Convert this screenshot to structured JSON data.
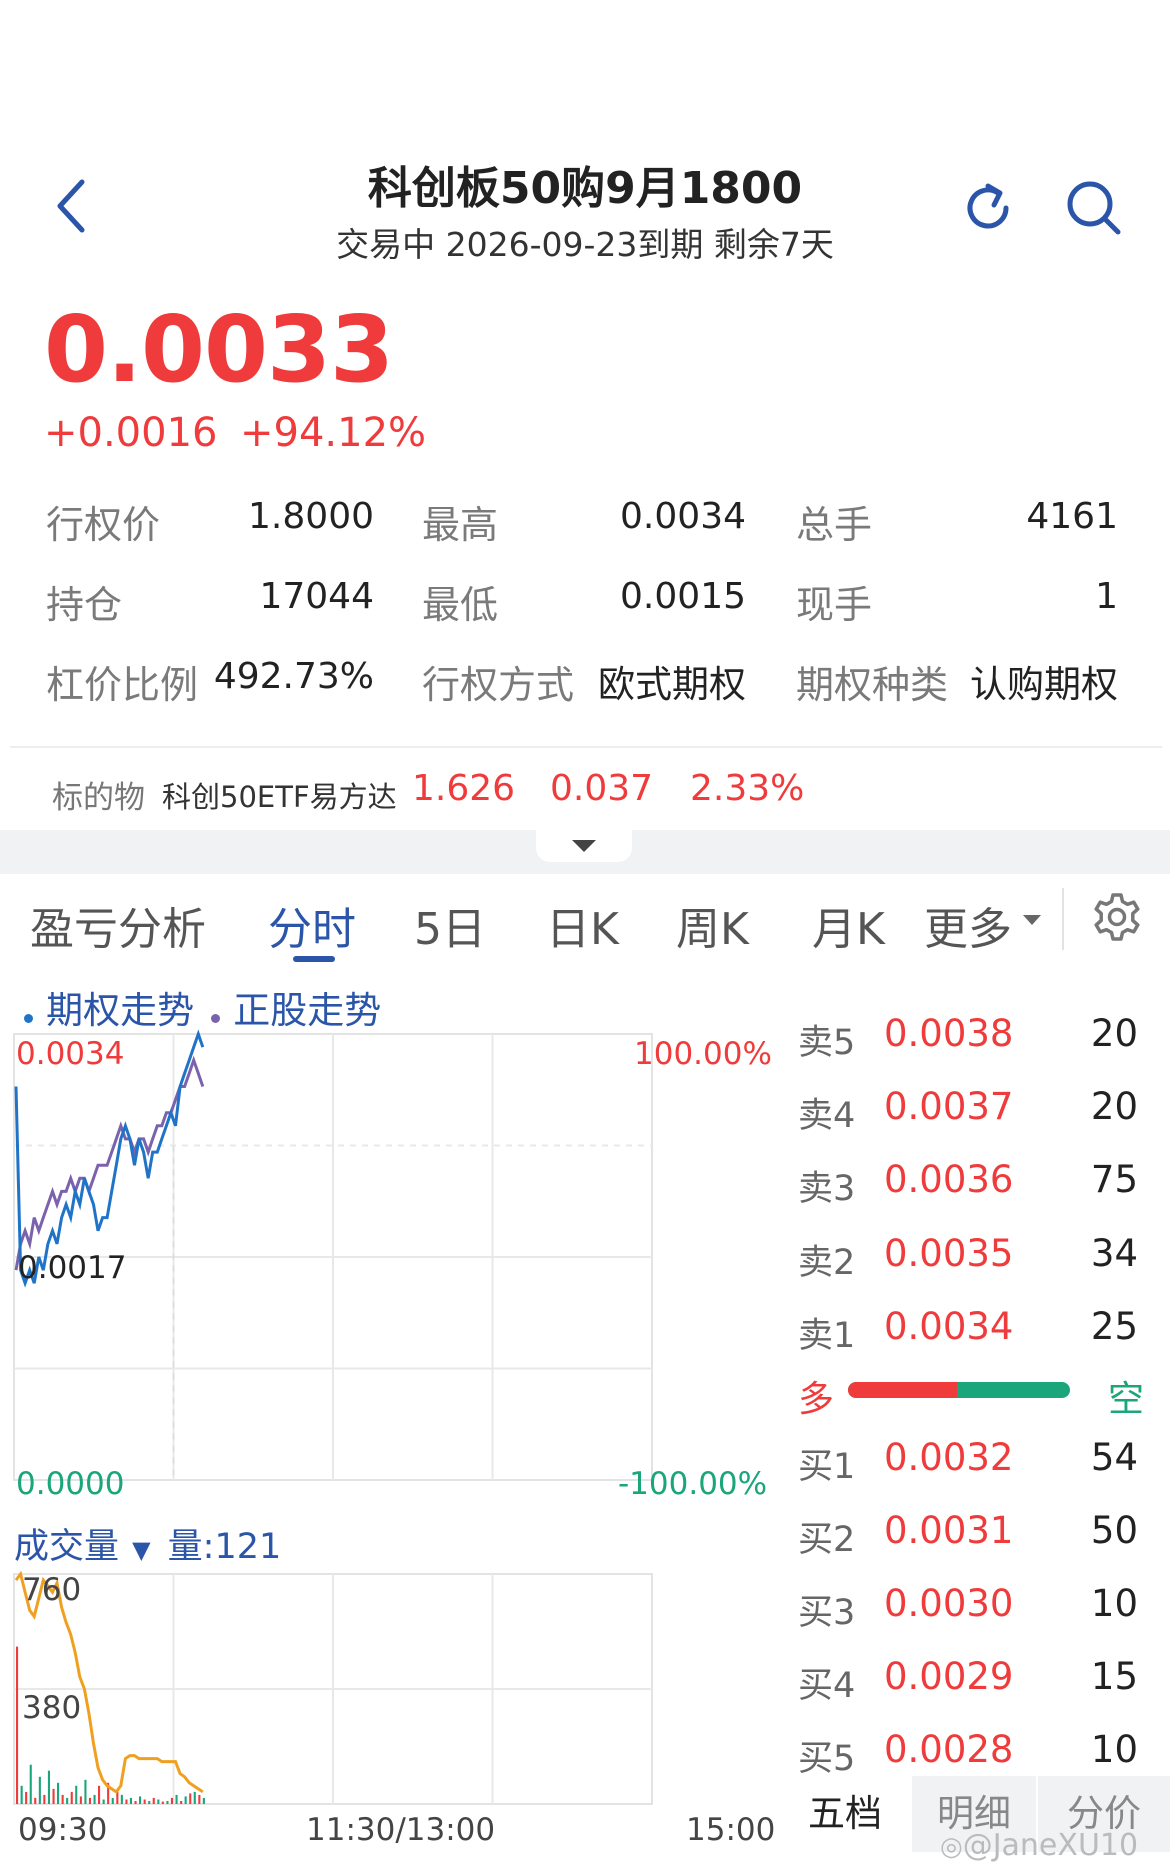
{
  "header": {
    "title": "科创板50购9月1800",
    "subtitle": "交易中 2026-09-23到期 剩余7天"
  },
  "quote": {
    "price": "0.0033",
    "change": "+0.0016",
    "change_pct": "+94.12%"
  },
  "stats": [
    {
      "label": "行权价",
      "value": "1.8000",
      "color": "#222222"
    },
    {
      "label": "最高",
      "value": "0.0034",
      "color": "#ef3b3b"
    },
    {
      "label": "总手",
      "value": "4161",
      "color": "#222222"
    },
    {
      "label": "持仓",
      "value": "17044",
      "color": "#222222"
    },
    {
      "label": "最低",
      "value": "0.0015",
      "color": "#1aa67a"
    },
    {
      "label": "现手",
      "value": "1",
      "color": "#222222"
    },
    {
      "label": "杠价比例",
      "value": "492.73%",
      "color": "#222222"
    },
    {
      "label": "行权方式",
      "value": "欧式期权",
      "color": "#222222"
    },
    {
      "label": "期权种类",
      "value": "认购期权",
      "color": "#222222"
    }
  ],
  "underlying": {
    "label": "标的物",
    "name": "科创50ETF易方达",
    "price": "1.626",
    "change": "0.037",
    "change_pct": "2.33%"
  },
  "tabs": [
    "盈亏分析",
    "分时",
    "5日",
    "日K",
    "周K",
    "月K",
    "更多"
  ],
  "active_tab": "分时",
  "legend": {
    "option": "期权走势",
    "stock": "正股走势"
  },
  "chart_data": [
    {
      "type": "line",
      "title": "",
      "series": [
        {
          "name": "期权走势",
          "color": "#1f74c8",
          "values": [
            0.003,
            0.0016,
            0.0015,
            0.0016,
            0.0015,
            0.0017,
            0.0016,
            0.0018,
            0.0019,
            0.0018,
            0.002,
            0.0021,
            0.002,
            0.0022,
            0.0021,
            0.0023,
            0.0022,
            0.0021,
            0.0019,
            0.002,
            0.002,
            0.0022,
            0.0024,
            0.0026,
            0.0027,
            0.0026,
            0.0024,
            0.0026,
            0.0025,
            0.0023,
            0.0025,
            0.0025,
            0.0026,
            0.0027,
            0.0028,
            0.0027,
            0.003,
            0.0031,
            0.0032,
            0.0033,
            0.0034,
            0.0033
          ]
        },
        {
          "name": "正股走势",
          "color": "#7b62ad",
          "values": [
            0.0016,
            0.0018,
            0.0019,
            0.0018,
            0.002,
            0.0019,
            0.002,
            0.0021,
            0.0022,
            0.0021,
            0.0022,
            0.0022,
            0.0023,
            0.0022,
            0.0023,
            0.0023,
            0.0022,
            0.0023,
            0.0024,
            0.0024,
            0.0024,
            0.0025,
            0.0026,
            0.0027,
            0.0026,
            0.0026,
            0.0025,
            0.0026,
            0.0026,
            0.0025,
            0.0026,
            0.0027,
            0.0027,
            0.0028,
            0.0028,
            0.0029,
            0.003,
            0.003,
            0.0031,
            0.0032,
            0.0031,
            0.003
          ]
        }
      ],
      "ylim": [
        0.0,
        0.0034
      ],
      "y_ticks_left": [
        "0.0034",
        "0.0017",
        "0.0000"
      ],
      "y_ticks_right": [
        "100.00%",
        "-100.00%"
      ],
      "grid": true
    },
    {
      "type": "bar",
      "title": "成交量",
      "volume_label": "量:121",
      "ylim": [
        0,
        760
      ],
      "y_ticks": [
        "760",
        "380"
      ],
      "x_ticks": [
        "09:30",
        "11:30/13:00",
        "15:00"
      ],
      "values": [
        520,
        60,
        40,
        130,
        20,
        90,
        30,
        110,
        50,
        70,
        30,
        20,
        40,
        60,
        25,
        80,
        20,
        30,
        60,
        15,
        70,
        20,
        40,
        30,
        15,
        20,
        10,
        25,
        15,
        10,
        20,
        15,
        8,
        10,
        20,
        30,
        10,
        25,
        35,
        40,
        30,
        20
      ],
      "bar_colors": [
        "#ef3b3b",
        "#1aa67a"
      ],
      "series": [
        {
          "name": "",
          "color": "#f0a020",
          "values": [
            740,
            760,
            700,
            640,
            620,
            680,
            740,
            720,
            700,
            730,
            650,
            600,
            560,
            500,
            420,
            380,
            300,
            200,
            120,
            80,
            60,
            50,
            40,
            60,
            150,
            160,
            160,
            150,
            150,
            150,
            150,
            150,
            140,
            140,
            140,
            140,
            100,
            90,
            70,
            60,
            50,
            40
          ]
        }
      ]
    }
  ],
  "volume": {
    "label": "成交量",
    "amount": "量:121"
  },
  "orderbook": {
    "asks": [
      {
        "label": "卖5",
        "price": "0.0038",
        "qty": "20"
      },
      {
        "label": "卖4",
        "price": "0.0037",
        "qty": "20"
      },
      {
        "label": "卖3",
        "price": "0.0036",
        "qty": "75"
      },
      {
        "label": "卖2",
        "price": "0.0035",
        "qty": "34"
      },
      {
        "label": "卖1",
        "price": "0.0034",
        "qty": "25"
      }
    ],
    "long_label": "多",
    "short_label": "空",
    "long_ratio": 0.49,
    "bids": [
      {
        "label": "买1",
        "price": "0.0032",
        "qty": "54"
      },
      {
        "label": "买2",
        "price": "0.0031",
        "qty": "50"
      },
      {
        "label": "买3",
        "price": "0.0030",
        "qty": "10"
      },
      {
        "label": "买4",
        "price": "0.0029",
        "qty": "15"
      },
      {
        "label": "买5",
        "price": "0.0028",
        "qty": "10"
      }
    ]
  },
  "bottom_tabs": [
    "五档",
    "明细",
    "分价"
  ],
  "watermark": "@JaneXU10",
  "colors": {
    "up": "#ef3b3b",
    "down": "#1aa67a",
    "accent": "#2b55a8"
  },
  "icons": [
    "back-chevron-icon",
    "refresh-icon",
    "search-icon",
    "settings-gear-icon",
    "dropdown-caret-icon",
    "weibo-icon"
  ]
}
